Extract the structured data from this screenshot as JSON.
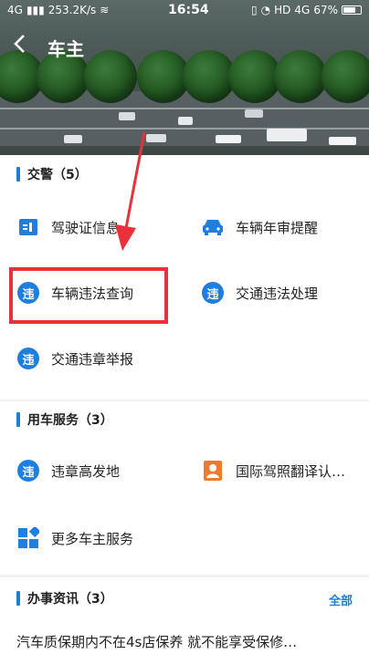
{
  "status": {
    "network": "4G",
    "speed": "253.2K/s",
    "time": "16:54",
    "hd": "HD",
    "net2": "4G",
    "battery": "67%"
  },
  "header": {
    "back_icon": "back-arrow-icon",
    "title": "车主"
  },
  "sections": [
    {
      "title": "交警（5）",
      "items": [
        {
          "label": "驾驶证信息",
          "icon": "license-icon"
        },
        {
          "label": "车辆年审提醒",
          "icon": "car-icon"
        },
        {
          "label": "车辆违法查询",
          "icon": "violation-icon"
        },
        {
          "label": "交通违法处理",
          "icon": "violation-icon"
        },
        {
          "label": "交通违章举报",
          "icon": "violation-icon"
        }
      ]
    },
    {
      "title": "用车服务（3）",
      "items": [
        {
          "label": "违章高发地",
          "icon": "violation-icon"
        },
        {
          "label": "国际驾照翻译认…",
          "icon": "person-card-icon"
        },
        {
          "label": "更多车主服务",
          "icon": "grid-icon"
        }
      ]
    },
    {
      "title": "办事资讯（3）",
      "action": "全部"
    }
  ],
  "news": "汽车质保期内不在4s店保养 就不能享受保修…",
  "violation_glyph": "违",
  "colors": {
    "accent": "#1c7ed6",
    "highlight": "#e8313a",
    "orange": "#f07a2c"
  }
}
